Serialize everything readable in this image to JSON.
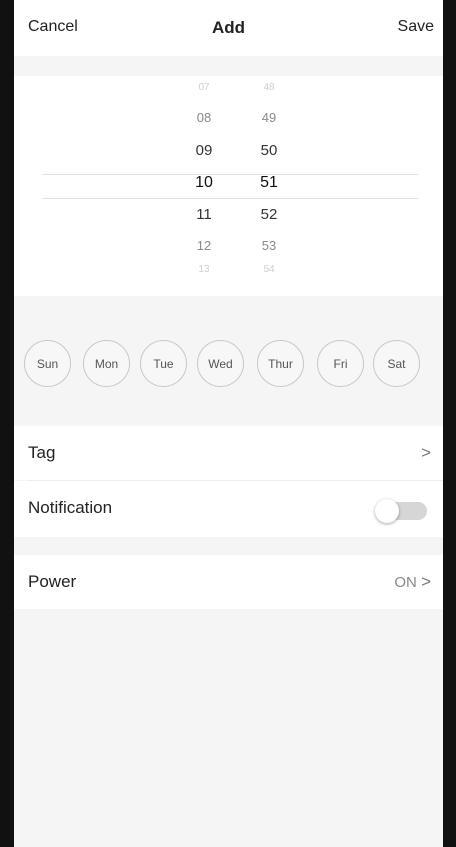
{
  "header": {
    "cancel_label": "Cancel",
    "title": "Add",
    "save_label": "Save"
  },
  "picker": {
    "hours": [
      "07",
      "08",
      "09",
      "10",
      "11",
      "12",
      "13"
    ],
    "minutes": [
      "48",
      "49",
      "50",
      "51",
      "52",
      "53",
      "54"
    ],
    "selected_hour": "10",
    "selected_minute": "51"
  },
  "days": [
    "Sun",
    "Mon",
    "Tue",
    "Wed",
    "Thur",
    "Fri",
    "Sat"
  ],
  "rows": {
    "tag": {
      "label": "Tag",
      "chevron": ">"
    },
    "notification": {
      "label": "Notification",
      "enabled": false
    },
    "power": {
      "label": "Power",
      "value": "ON",
      "chevron": ">"
    }
  },
  "colors": {
    "frame_background": "#f5f5f5",
    "row_background": "#ffffff",
    "toggle_off": "#d6d6d6"
  }
}
